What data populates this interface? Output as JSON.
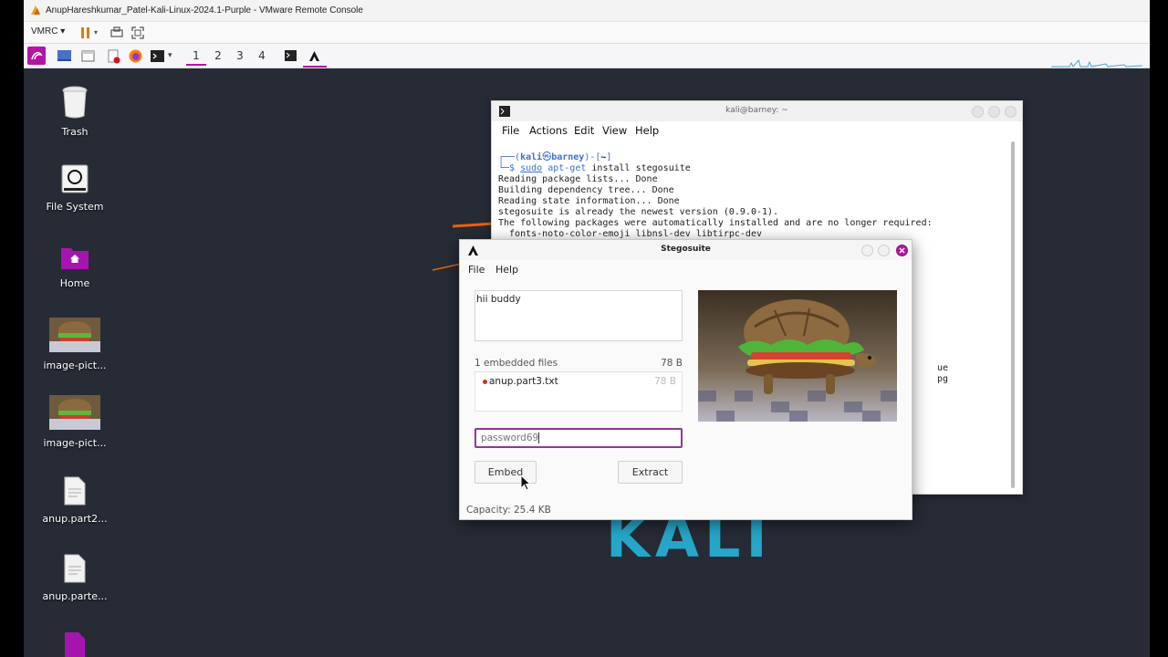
{
  "vmware": {
    "title": "AnupHareshkumar_Patel-Kali-Linux-2024.1-Purple - VMware Remote Console",
    "menu_label": "VMRC"
  },
  "panel": {
    "workspaces": [
      "1",
      "2",
      "3",
      "4"
    ],
    "active_workspace": "1"
  },
  "desktop": {
    "icons": [
      {
        "label": "Trash",
        "icon": "trash-icon"
      },
      {
        "label": "File System",
        "icon": "drive-icon"
      },
      {
        "label": "Home",
        "icon": "home-folder-icon"
      },
      {
        "label": "image-pict...",
        "icon": "image-thumbnail"
      },
      {
        "label": "image-pict...",
        "icon": "image-thumbnail"
      },
      {
        "label": "anup.part2...",
        "icon": "document-icon"
      },
      {
        "label": "anup.parte...",
        "icon": "document-icon"
      }
    ],
    "wallpaper_text": "KALI"
  },
  "terminal": {
    "title": "kali@barney: ~",
    "menu": [
      "File",
      "Actions",
      "Edit",
      "View",
      "Help"
    ],
    "prompt_user": "kali",
    "prompt_at": "㉿",
    "prompt_host": "barney",
    "prompt_dir": "~",
    "command_sudo": "sudo",
    "command_apt": "apt-get",
    "command_rest": "install stegosuite",
    "output": [
      "Reading package lists... Done",
      "Building dependency tree... Done",
      "Reading state information... Done",
      "stegosuite is already the newest version (0.9.0-1).",
      "The following packages were automatically installed and are no longer required:",
      "  fonts-noto-color-emoji libnsl-dev libtirpc-dev"
    ],
    "hidden_fragments": [
      "ue",
      "pg"
    ]
  },
  "stegosuite": {
    "title": "Stegosuite",
    "menu": [
      "File",
      "Help"
    ],
    "message": "hii buddy",
    "embedded_files_label": "1 embedded files",
    "embedded_files_size": "78 B",
    "files": [
      {
        "name": "anup.part3.txt",
        "size": "78 B"
      }
    ],
    "password": "password69",
    "embed_label": "Embed",
    "extract_label": "Extract",
    "capacity": "Capacity: 25.4 KB"
  },
  "colors": {
    "accent": "#8e3a94",
    "kali_purple": "#b514a5",
    "desktop_bg": "#262b36",
    "kali_blue": "#26a7c9"
  }
}
